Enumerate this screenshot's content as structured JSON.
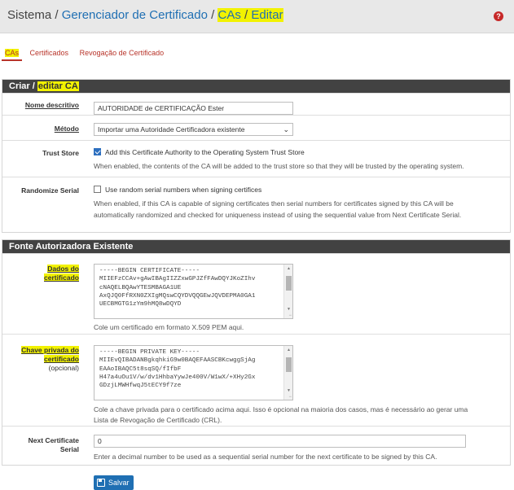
{
  "breadcrumb": {
    "root": "Sistema",
    "sep": "/",
    "level1": "Gerenciador de Certificado",
    "level2": "CAs",
    "level3": "Editar"
  },
  "help_icon": "question-circle-icon",
  "tabs": [
    {
      "label": "CAs",
      "active": true
    },
    {
      "label": "Certificados",
      "active": false
    },
    {
      "label": "Revogação de Certificado",
      "active": false
    }
  ],
  "section_edit": {
    "title_prefix": "Criar /",
    "title_highlight": "editar CA",
    "name_label": "Nome descritivo",
    "name_value": "AUTORIDADE de CERTIFICAÇÃO Ester",
    "method_label": "Método",
    "method_value": "Importar uma Autoridade Certificadora existente",
    "trust_label": "Trust Store",
    "trust_checkbox": "Add this Certificate Authority to the Operating System Trust Store",
    "trust_checked": true,
    "trust_help": "When enabled, the contents of the CA will be added to the trust store so that they will be trusted by the operating system.",
    "serial_label": "Randomize Serial",
    "serial_checkbox": "Use random serial numbers when signing certifices",
    "serial_checked": false,
    "serial_help_1": "When enabled, if this CA is capable of signing certificates then serial numbers for certificates signed by this CA will be",
    "serial_help_2": "automatically randomized and checked for uniqueness instead of using the sequential value from Next Certificate Serial."
  },
  "section_existing": {
    "title": "Fonte Autorizadora Existente",
    "cert_label_1": "Dados do",
    "cert_label_2": "certificado",
    "cert_text": "-----BEGIN CERTIFICATE-----\nMIIEFzCCAv+gAwIBAgIIZZxwGPJZfFAwDQYJKoZIhv\ncNAQELBQAwYTESMBAGA1UE\nAxQJQ0FfRXN0ZXIgMQswCQYDVQQGEwJQVDEPMA0GA1\nUECBMGTG1zYm9hMQ8wDQYD",
    "cert_help": "Cole um certificado em formato X.509 PEM aqui.",
    "key_label_1": "Chave privada do",
    "key_label_2": "certificado",
    "key_label_3": "(opcional)",
    "key_text": "-----BEGIN PRIVATE KEY-----\nMIIEvQIBADANBgkqhkiG9w0BAQEFAASCBKcwggSjAg\nEAAoIBAQC5t8sqSQ/fIfbF\nH47a4uOu1V/w/dv1HhbaYywJe400V/W1wX/+XHy2Gx\nGDzjLMWHfwqJ5tECY9f7ze",
    "key_help_1": "Cole a chave privada para o certificado acima aqui. Isso é opcional na maioria dos casos, mas é necessário ao gerar uma",
    "key_help_2": "Lista de Revogação de Certificado (CRL).",
    "next_label_1": "Next Certificate",
    "next_label_2": "Serial",
    "next_value": "0",
    "next_help": "Enter a decimal number to be used as a sequential serial number for the next certificate to be signed by this CA."
  },
  "save_button": "Salvar",
  "colors": {
    "link": "#1f6fb3",
    "tab_red": "#b8342a",
    "panel_header": "#424242",
    "highlight": "#f2f200",
    "button": "#1f6fb3"
  }
}
